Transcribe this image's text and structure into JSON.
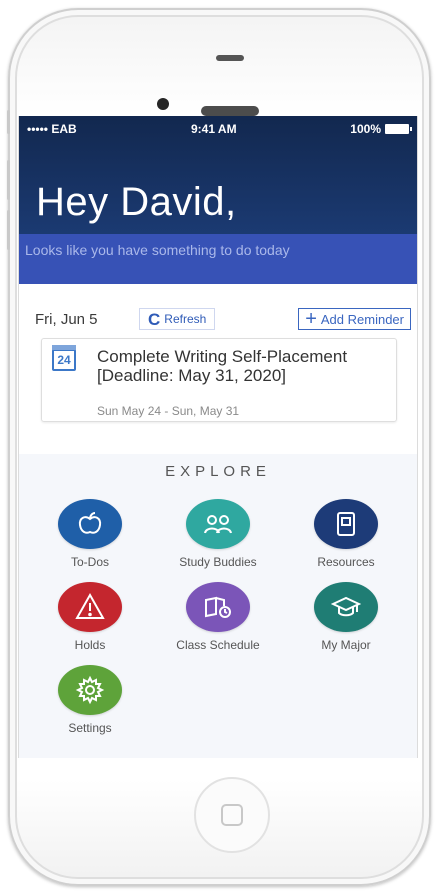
{
  "status_bar": {
    "carrier": "••••• EAB",
    "time": "9:41 AM",
    "battery": "100%"
  },
  "header": {
    "greeting": "Hey David,",
    "subtitle": "Looks like you have something to do today"
  },
  "reminders": {
    "date": "Fri, Jun 5",
    "refresh_label": "Refresh",
    "add_reminder_label": "Add Reminder",
    "items": [
      {
        "icon_text": "24",
        "title": "Complete Writing Self-Placement [Deadline: May 31, 2020]",
        "dates": "Sun May 24 - Sun, May 31"
      }
    ]
  },
  "explore": {
    "title": "EXPLORE",
    "tiles": [
      {
        "label": "To-Dos",
        "icon": "apple-icon",
        "color": "#1f5fa8"
      },
      {
        "label": "Study Buddies",
        "icon": "people-icon",
        "color": "#2fa8a0"
      },
      {
        "label": "Resources",
        "icon": "book-icon",
        "color": "#1d3b78"
      },
      {
        "label": "Holds",
        "icon": "warning-icon",
        "color": "#c4262e"
      },
      {
        "label": "Class Schedule",
        "icon": "schedule-icon",
        "color": "#7b55b8"
      },
      {
        "label": "My Major",
        "icon": "graduation-cap-icon",
        "color": "#1f7d74"
      },
      {
        "label": "Settings",
        "icon": "gear-icon",
        "color": "#5ea33a"
      }
    ]
  }
}
